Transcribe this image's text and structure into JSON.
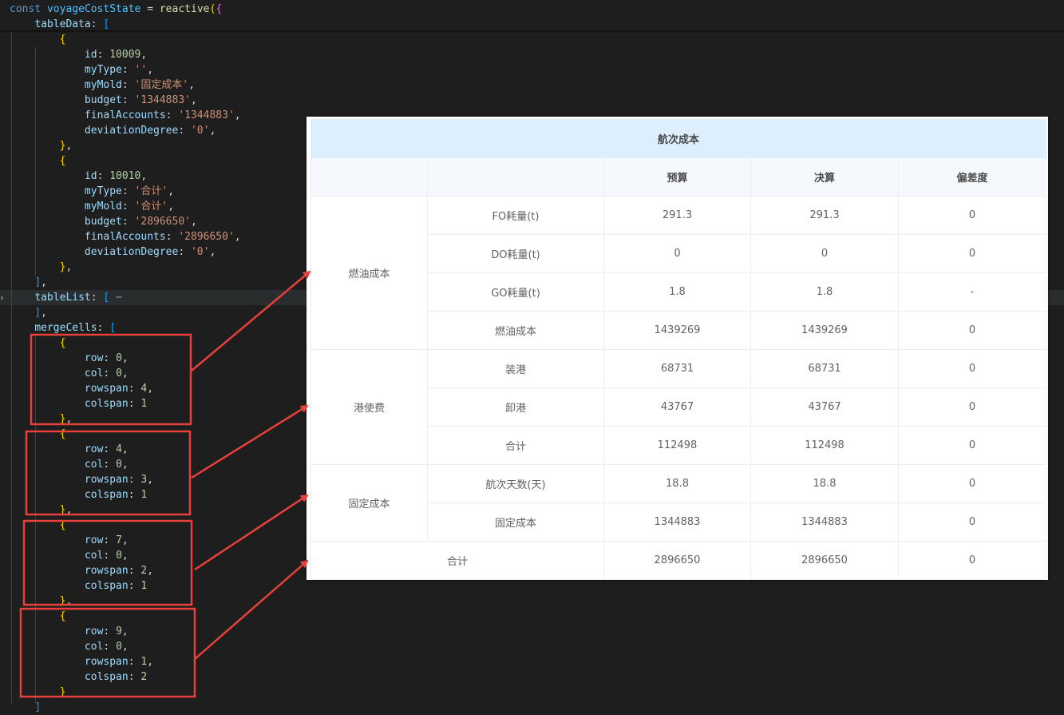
{
  "editor": {
    "lines": [
      [
        [
          "kw",
          "const "
        ],
        [
          "var",
          "voyageCostState"
        ],
        [
          "p",
          " = "
        ],
        [
          "fn",
          "reactive"
        ],
        [
          "b1",
          "("
        ],
        [
          "b2",
          "{"
        ]
      ],
      [
        [
          "p",
          "    "
        ],
        [
          "prop",
          "tableData"
        ],
        [
          "p",
          ": "
        ],
        [
          "b3",
          "["
        ]
      ],
      [
        [
          "p",
          "        "
        ],
        [
          "b1",
          "{"
        ]
      ],
      [
        [
          "p",
          "            "
        ],
        [
          "prop",
          "id"
        ],
        [
          "p",
          ": "
        ],
        [
          "num",
          "10009"
        ],
        [
          "p",
          ","
        ]
      ],
      [
        [
          "p",
          "            "
        ],
        [
          "prop",
          "myType"
        ],
        [
          "p",
          ": "
        ],
        [
          "str",
          "''"
        ],
        [
          "p",
          ","
        ]
      ],
      [
        [
          "p",
          "            "
        ],
        [
          "prop",
          "myMold"
        ],
        [
          "p",
          ": "
        ],
        [
          "str",
          "'固定成本'"
        ],
        [
          "p",
          ","
        ]
      ],
      [
        [
          "p",
          "            "
        ],
        [
          "prop",
          "budget"
        ],
        [
          "p",
          ": "
        ],
        [
          "str",
          "'1344883'"
        ],
        [
          "p",
          ","
        ]
      ],
      [
        [
          "p",
          "            "
        ],
        [
          "prop",
          "finalAccounts"
        ],
        [
          "p",
          ": "
        ],
        [
          "str",
          "'1344883'"
        ],
        [
          "p",
          ","
        ]
      ],
      [
        [
          "p",
          "            "
        ],
        [
          "prop",
          "deviationDegree"
        ],
        [
          "p",
          ": "
        ],
        [
          "str",
          "'0'"
        ],
        [
          "p",
          ","
        ]
      ],
      [
        [
          "p",
          "        "
        ],
        [
          "b1",
          "}"
        ],
        [
          "p",
          ","
        ]
      ],
      [
        [
          "p",
          "        "
        ],
        [
          "b1",
          "{"
        ]
      ],
      [
        [
          "p",
          "            "
        ],
        [
          "prop",
          "id"
        ],
        [
          "p",
          ": "
        ],
        [
          "num",
          "10010"
        ],
        [
          "p",
          ","
        ]
      ],
      [
        [
          "p",
          "            "
        ],
        [
          "prop",
          "myType"
        ],
        [
          "p",
          ": "
        ],
        [
          "str",
          "'合计'"
        ],
        [
          "p",
          ","
        ]
      ],
      [
        [
          "p",
          "            "
        ],
        [
          "prop",
          "myMold"
        ],
        [
          "p",
          ": "
        ],
        [
          "str",
          "'合计'"
        ],
        [
          "p",
          ","
        ]
      ],
      [
        [
          "p",
          "            "
        ],
        [
          "prop",
          "budget"
        ],
        [
          "p",
          ": "
        ],
        [
          "str",
          "'2896650'"
        ],
        [
          "p",
          ","
        ]
      ],
      [
        [
          "p",
          "            "
        ],
        [
          "prop",
          "finalAccounts"
        ],
        [
          "p",
          ": "
        ],
        [
          "str",
          "'2896650'"
        ],
        [
          "p",
          ","
        ]
      ],
      [
        [
          "p",
          "            "
        ],
        [
          "prop",
          "deviationDegree"
        ],
        [
          "p",
          ": "
        ],
        [
          "str",
          "'0'"
        ],
        [
          "p",
          ","
        ]
      ],
      [
        [
          "p",
          "        "
        ],
        [
          "b1",
          "}"
        ],
        [
          "p",
          ","
        ]
      ],
      [
        [
          "p",
          "    "
        ],
        [
          "b3",
          "]"
        ],
        [
          "p",
          ","
        ]
      ],
      [
        [
          "p",
          "    "
        ],
        [
          "prop",
          "tableList"
        ],
        [
          "p",
          ": "
        ],
        [
          "b3",
          "["
        ],
        [
          "ell",
          " ⋯"
        ]
      ],
      [
        [
          "p",
          "    "
        ],
        [
          "b3",
          "]"
        ],
        [
          "p",
          ","
        ]
      ],
      [
        [
          "p",
          "    "
        ],
        [
          "prop",
          "mergeCells"
        ],
        [
          "p",
          ": "
        ],
        [
          "b3",
          "["
        ]
      ],
      [
        [
          "p",
          "        "
        ],
        [
          "b1",
          "{"
        ]
      ],
      [
        [
          "p",
          "            "
        ],
        [
          "prop",
          "row"
        ],
        [
          "p",
          ": "
        ],
        [
          "num",
          "0"
        ],
        [
          "p",
          ","
        ]
      ],
      [
        [
          "p",
          "            "
        ],
        [
          "prop",
          "col"
        ],
        [
          "p",
          ": "
        ],
        [
          "num",
          "0"
        ],
        [
          "p",
          ","
        ]
      ],
      [
        [
          "p",
          "            "
        ],
        [
          "prop",
          "rowspan"
        ],
        [
          "p",
          ": "
        ],
        [
          "num",
          "4"
        ],
        [
          "p",
          ","
        ]
      ],
      [
        [
          "p",
          "            "
        ],
        [
          "prop",
          "colspan"
        ],
        [
          "p",
          ": "
        ],
        [
          "num",
          "1"
        ]
      ],
      [
        [
          "p",
          "        "
        ],
        [
          "b1",
          "}"
        ],
        [
          "p",
          ","
        ]
      ],
      [
        [
          "p",
          "        "
        ],
        [
          "b1",
          "{"
        ]
      ],
      [
        [
          "p",
          "            "
        ],
        [
          "prop",
          "row"
        ],
        [
          "p",
          ": "
        ],
        [
          "num",
          "4"
        ],
        [
          "p",
          ","
        ]
      ],
      [
        [
          "p",
          "            "
        ],
        [
          "prop",
          "col"
        ],
        [
          "p",
          ": "
        ],
        [
          "num",
          "0"
        ],
        [
          "p",
          ","
        ]
      ],
      [
        [
          "p",
          "            "
        ],
        [
          "prop",
          "rowspan"
        ],
        [
          "p",
          ": "
        ],
        [
          "num",
          "3"
        ],
        [
          "p",
          ","
        ]
      ],
      [
        [
          "p",
          "            "
        ],
        [
          "prop",
          "colspan"
        ],
        [
          "p",
          ": "
        ],
        [
          "num",
          "1"
        ]
      ],
      [
        [
          "p",
          "        "
        ],
        [
          "b1",
          "}"
        ],
        [
          "p",
          ","
        ]
      ],
      [
        [
          "p",
          "        "
        ],
        [
          "b1",
          "{"
        ]
      ],
      [
        [
          "p",
          "            "
        ],
        [
          "prop",
          "row"
        ],
        [
          "p",
          ": "
        ],
        [
          "num",
          "7"
        ],
        [
          "p",
          ","
        ]
      ],
      [
        [
          "p",
          "            "
        ],
        [
          "prop",
          "col"
        ],
        [
          "p",
          ": "
        ],
        [
          "num",
          "0"
        ],
        [
          "p",
          ","
        ]
      ],
      [
        [
          "p",
          "            "
        ],
        [
          "prop",
          "rowspan"
        ],
        [
          "p",
          ": "
        ],
        [
          "num",
          "2"
        ],
        [
          "p",
          ","
        ]
      ],
      [
        [
          "p",
          "            "
        ],
        [
          "prop",
          "colspan"
        ],
        [
          "p",
          ": "
        ],
        [
          "num",
          "1"
        ]
      ],
      [
        [
          "p",
          "        "
        ],
        [
          "b1",
          "}"
        ],
        [
          "p",
          ","
        ]
      ],
      [
        [
          "p",
          "        "
        ],
        [
          "b1",
          "{"
        ]
      ],
      [
        [
          "p",
          "            "
        ],
        [
          "prop",
          "row"
        ],
        [
          "p",
          ": "
        ],
        [
          "num",
          "9"
        ],
        [
          "p",
          ","
        ]
      ],
      [
        [
          "p",
          "            "
        ],
        [
          "prop",
          "col"
        ],
        [
          "p",
          ": "
        ],
        [
          "num",
          "0"
        ],
        [
          "p",
          ","
        ]
      ],
      [
        [
          "p",
          "            "
        ],
        [
          "prop",
          "rowspan"
        ],
        [
          "p",
          ": "
        ],
        [
          "num",
          "1"
        ],
        [
          "p",
          ","
        ]
      ],
      [
        [
          "p",
          "            "
        ],
        [
          "prop",
          "colspan"
        ],
        [
          "p",
          ": "
        ],
        [
          "num",
          "2"
        ]
      ],
      [
        [
          "p",
          "        "
        ],
        [
          "b1",
          "}"
        ]
      ],
      [
        [
          "p",
          "    "
        ],
        [
          "b3",
          "]"
        ]
      ]
    ]
  },
  "table": {
    "title": "航次成本",
    "headers": [
      "",
      "",
      "预算",
      "决算",
      "偏差度"
    ],
    "groups": [
      {
        "name": "燃油成本",
        "rows": [
          [
            "FO耗量(t)",
            "291.3",
            "291.3",
            "0"
          ],
          [
            "DO耗量(t)",
            "0",
            "0",
            "0"
          ],
          [
            "GO耗量(t)",
            "1.8",
            "1.8",
            "-"
          ],
          [
            "燃油成本",
            "1439269",
            "1439269",
            "0"
          ]
        ]
      },
      {
        "name": "港使费",
        "rows": [
          [
            "装港",
            "68731",
            "68731",
            "0"
          ],
          [
            "卸港",
            "43767",
            "43767",
            "0"
          ],
          [
            "合计",
            "112498",
            "112498",
            "0"
          ]
        ]
      },
      {
        "name": "固定成本",
        "rows": [
          [
            "航次天数(天)",
            "18.8",
            "18.8",
            "0"
          ],
          [
            "固定成本",
            "1344883",
            "1344883",
            "0"
          ]
        ]
      }
    ],
    "total": [
      "合计",
      "2896650",
      "2896650",
      "0"
    ]
  },
  "annotation_color": "#e8403a"
}
